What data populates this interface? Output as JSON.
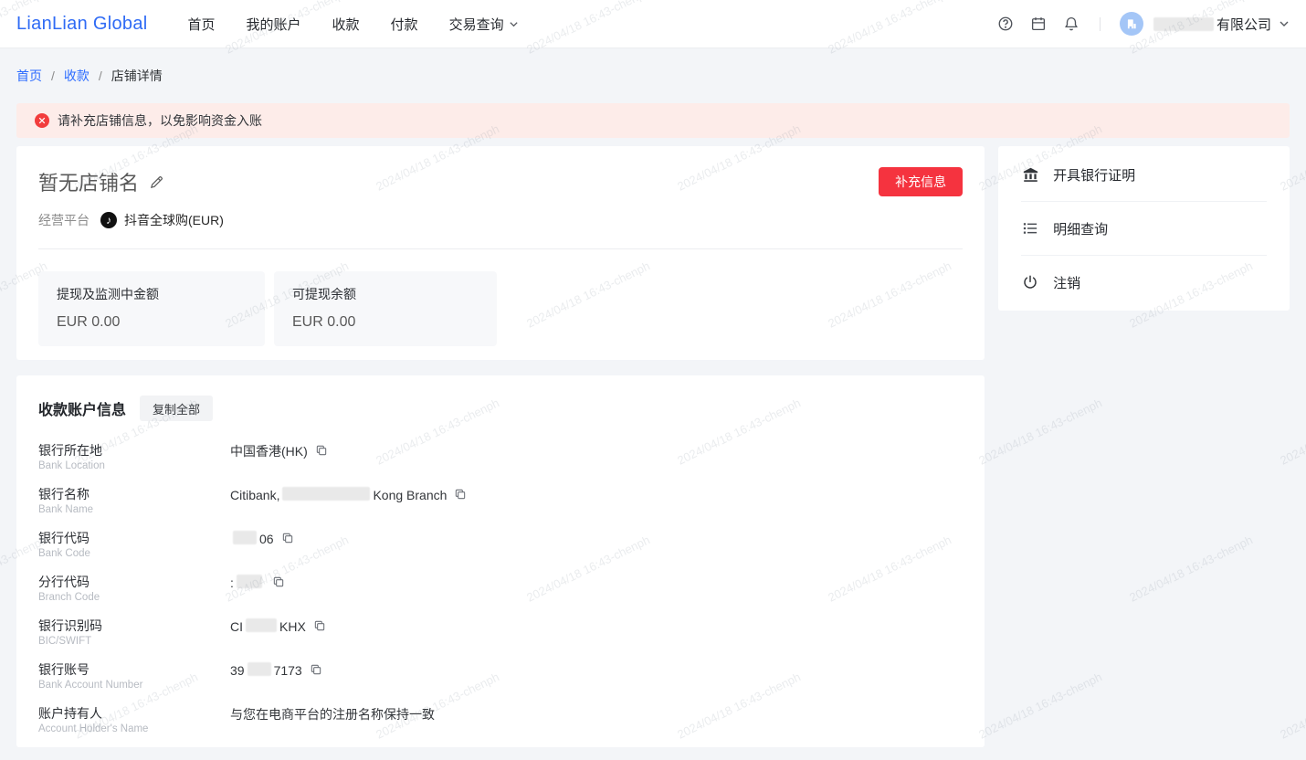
{
  "watermark": "2024/04/18 16:43-chenph",
  "header": {
    "logo": "LianLian Global",
    "nav": [
      {
        "label": "首页"
      },
      {
        "label": "我的账户"
      },
      {
        "label": "收款"
      },
      {
        "label": "付款"
      },
      {
        "label": "交易查询"
      }
    ],
    "icons": [
      "help-icon",
      "calendar-icon",
      "bell-icon"
    ],
    "account_company_suffix": "有限公司"
  },
  "breadcrumb": {
    "separator": "/",
    "items": [
      {
        "label": "首页"
      },
      {
        "label": "收款"
      },
      {
        "label": "店铺详情"
      }
    ]
  },
  "alert": {
    "message": "请补充店铺信息，以免影响资金入账"
  },
  "store": {
    "name": "暂无店铺名",
    "supplement_button": "补充信息",
    "platform_label": "经营平台",
    "platform_icon": "tiktok-icon",
    "platform_name": "抖音全球购(EUR)",
    "balances": [
      {
        "label": "提现及监测中金额",
        "value": "EUR 0.00"
      },
      {
        "label": "可提现余额",
        "value": "EUR 0.00"
      }
    ]
  },
  "side_actions": [
    {
      "icon": "bank-icon",
      "label": "开具银行证明"
    },
    {
      "icon": "list-icon",
      "label": "明细查询"
    },
    {
      "icon": "power-icon",
      "label": "注销"
    }
  ],
  "account_info": {
    "title": "收款账户信息",
    "copy_all": "复制全部",
    "rows": [
      {
        "label": "银行所在地",
        "sublabel": "Bank Location",
        "value_prefix": "中国香港(HK)",
        "value_suffix": "",
        "redacted": false,
        "copyable": true
      },
      {
        "label": "银行名称",
        "sublabel": "Bank Name",
        "value_prefix": "Citibank,",
        "value_suffix": "Kong Branch",
        "redacted": true,
        "copyable": true
      },
      {
        "label": "银行代码",
        "sublabel": "Bank Code",
        "value_prefix": "",
        "value_suffix": "06",
        "redacted": true,
        "copyable": true
      },
      {
        "label": "分行代码",
        "sublabel": "Branch Code",
        "value_prefix": ":",
        "value_suffix": "",
        "redacted": true,
        "copyable": true
      },
      {
        "label": "银行识别码",
        "sublabel": "BIC/SWIFT",
        "value_prefix": "CI",
        "value_suffix": "KHX",
        "redacted": true,
        "copyable": true
      },
      {
        "label": "银行账号",
        "sublabel": "Bank Account Number",
        "value_prefix": "39",
        "value_suffix": "7173",
        "redacted": true,
        "copyable": true
      },
      {
        "label": "账户持有人",
        "sublabel": "Account Holder's Name",
        "value_prefix": "与您在电商平台的注册名称保持一致",
        "value_suffix": "",
        "redacted": false,
        "copyable": false
      }
    ]
  },
  "colors": {
    "brand_blue": "#2f6bf5",
    "link_blue": "#2b6bff",
    "danger_red": "#f5333f",
    "alert_bg": "#fdece9",
    "page_bg": "#f3f5f8"
  }
}
